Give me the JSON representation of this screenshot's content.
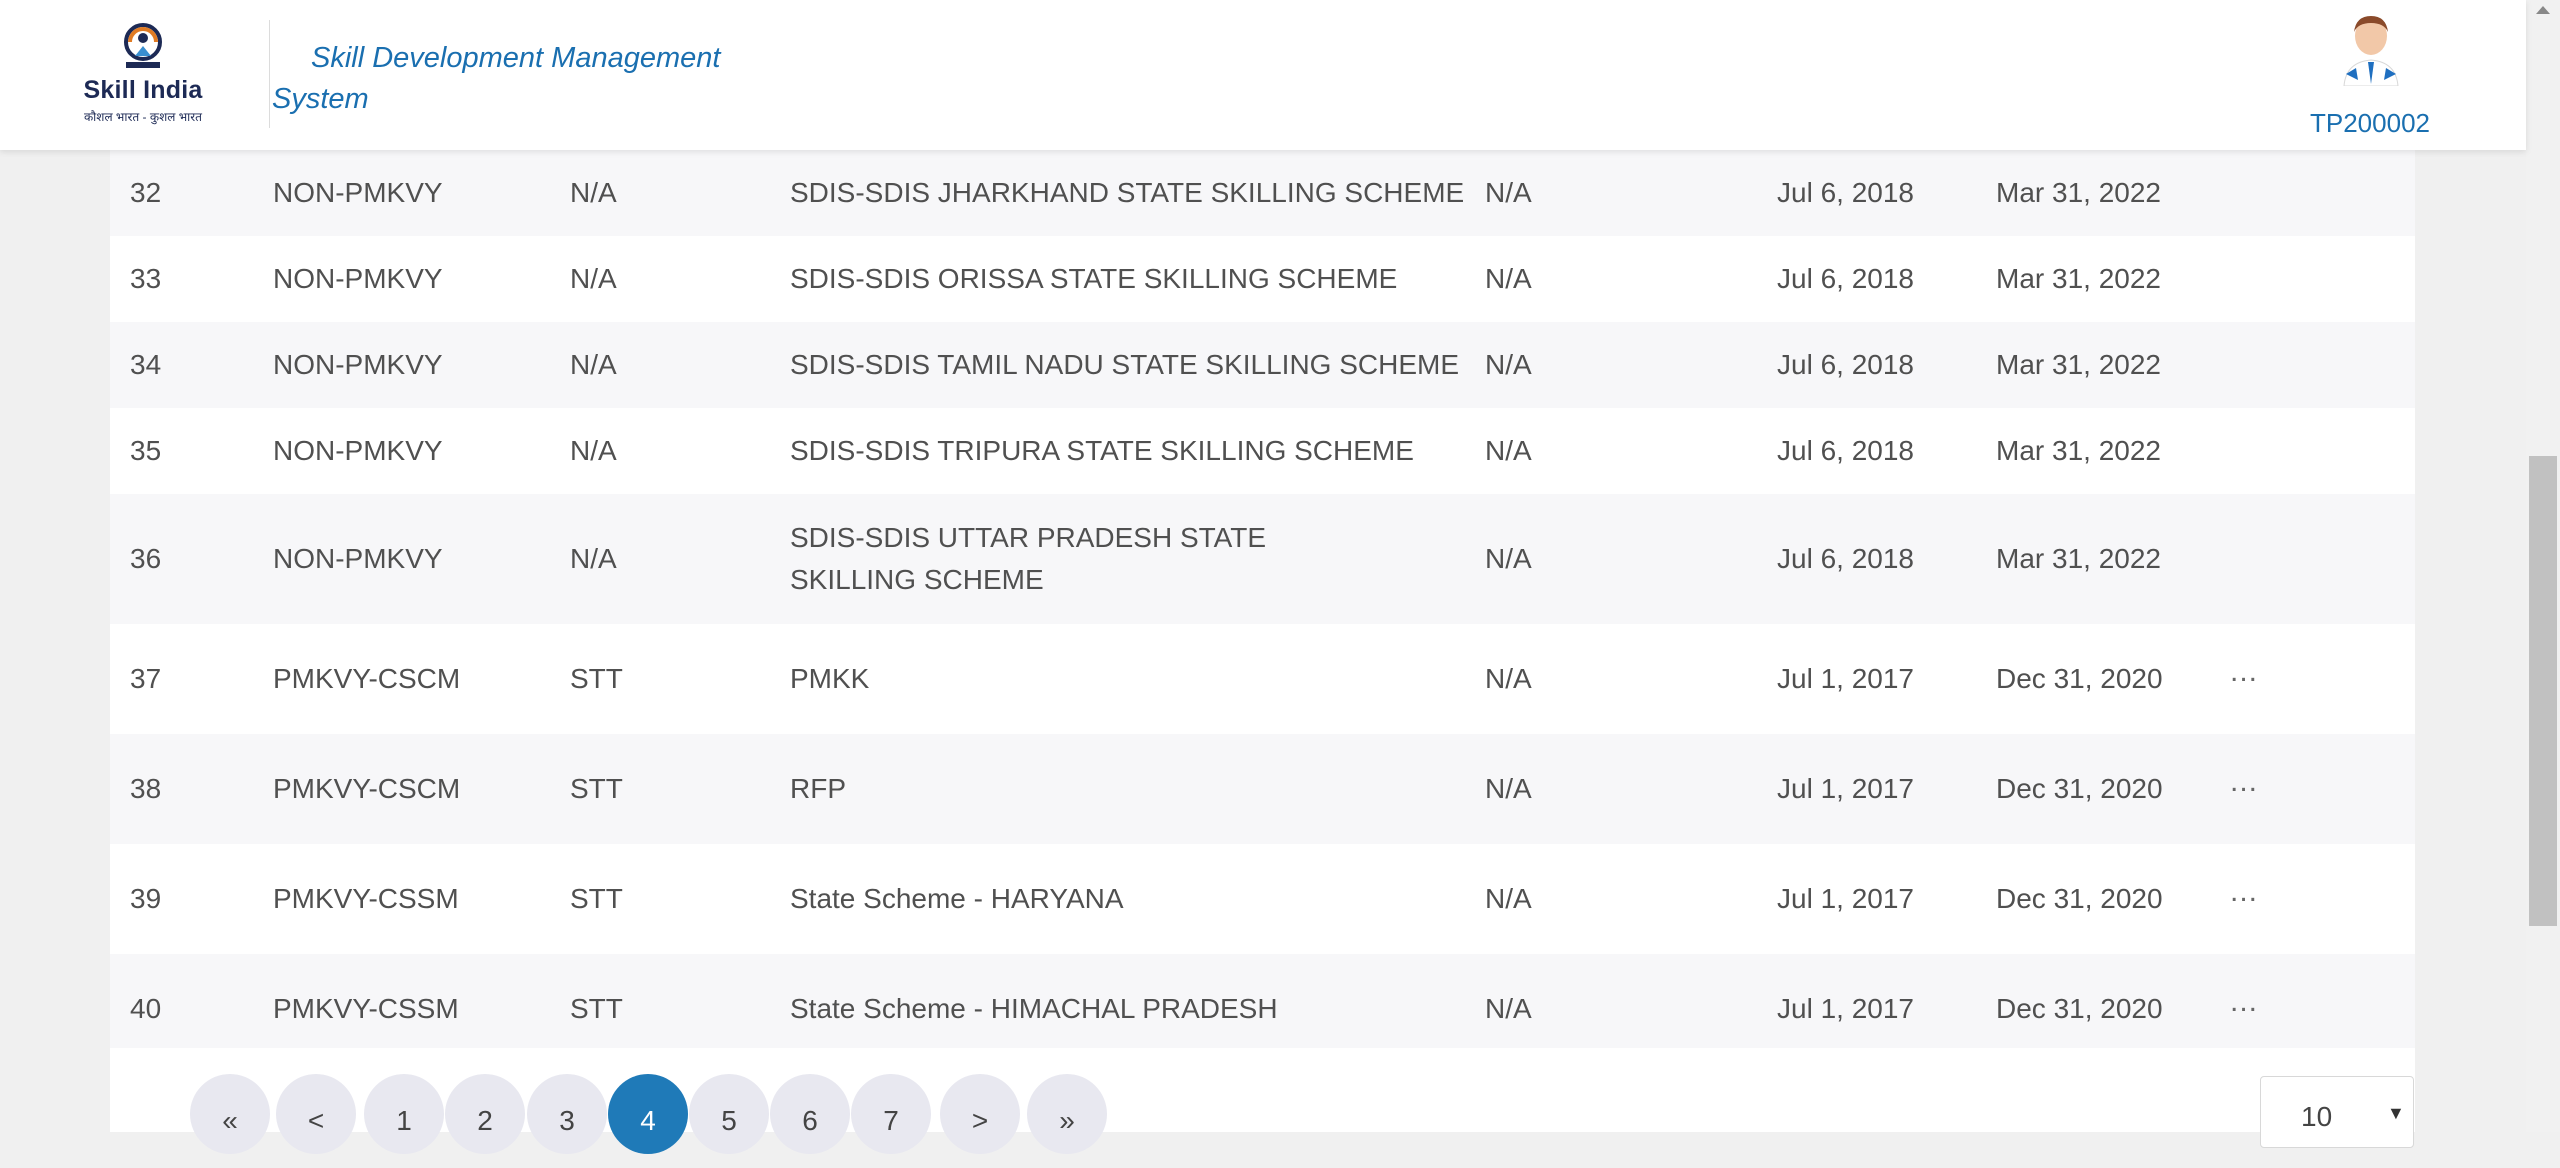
{
  "header": {
    "logo_text": "Skill India",
    "logo_tagline": "कौशल भारत - कुशल भारत",
    "app_title_line1": "Skill Development Management",
    "app_title_line2": "System",
    "user_id": "TP200002"
  },
  "table": {
    "rows": [
      {
        "no": "32",
        "scheme": "NON-PMKVY",
        "type": "N/A",
        "name": "SDIS-SDIS JHARKHAND STATE SKILLING SCHEME",
        "extra": "N/A",
        "start": "Jul 6, 2018",
        "end": "Mar 31, 2022",
        "action": ""
      },
      {
        "no": "33",
        "scheme": "NON-PMKVY",
        "type": "N/A",
        "name": "SDIS-SDIS ORISSA STATE SKILLING SCHEME",
        "extra": "N/A",
        "start": "Jul 6, 2018",
        "end": "Mar 31, 2022",
        "action": ""
      },
      {
        "no": "34",
        "scheme": "NON-PMKVY",
        "type": "N/A",
        "name": "SDIS-SDIS TAMIL NADU STATE SKILLING SCHEME",
        "extra": "N/A",
        "start": "Jul 6, 2018",
        "end": "Mar 31, 2022",
        "action": ""
      },
      {
        "no": "35",
        "scheme": "NON-PMKVY",
        "type": "N/A",
        "name": "SDIS-SDIS TRIPURA STATE SKILLING SCHEME",
        "extra": "N/A",
        "start": "Jul 6, 2018",
        "end": "Mar 31, 2022",
        "action": ""
      },
      {
        "no": "36",
        "scheme": "NON-PMKVY",
        "type": "N/A",
        "name": "SDIS-SDIS UTTAR PRADESH STATE SKILLING SCHEME",
        "extra": "N/A",
        "start": "Jul 6, 2018",
        "end": "Mar 31, 2022",
        "action": ""
      },
      {
        "no": "37",
        "scheme": "PMKVY-CSCM",
        "type": "STT",
        "name": "PMKK",
        "extra": "N/A",
        "start": "Jul 1, 2017",
        "end": "Dec 31, 2020",
        "action": "..."
      },
      {
        "no": "38",
        "scheme": "PMKVY-CSCM",
        "type": "STT",
        "name": "RFP",
        "extra": "N/A",
        "start": "Jul 1, 2017",
        "end": "Dec 31, 2020",
        "action": "..."
      },
      {
        "no": "39",
        "scheme": "PMKVY-CSSM",
        "type": "STT",
        "name": "State Scheme - HARYANA",
        "extra": "N/A",
        "start": "Jul 1, 2017",
        "end": "Dec 31, 2020",
        "action": "..."
      },
      {
        "no": "40",
        "scheme": "PMKVY-CSSM",
        "type": "STT",
        "name": "State Scheme - HIMACHAL PRADESH",
        "extra": "N/A",
        "start": "Jul 1, 2017",
        "end": "Dec 31, 2020",
        "action": "..."
      }
    ]
  },
  "pagination": {
    "first": "«",
    "prev": "<",
    "pages": [
      "1",
      "2",
      "3",
      "4",
      "5",
      "6",
      "7"
    ],
    "current": "4",
    "next": ">",
    "last": "»",
    "page_size": "10"
  },
  "colors": {
    "accent": "#1a6fb0",
    "active_page": "#1f7ab8"
  }
}
